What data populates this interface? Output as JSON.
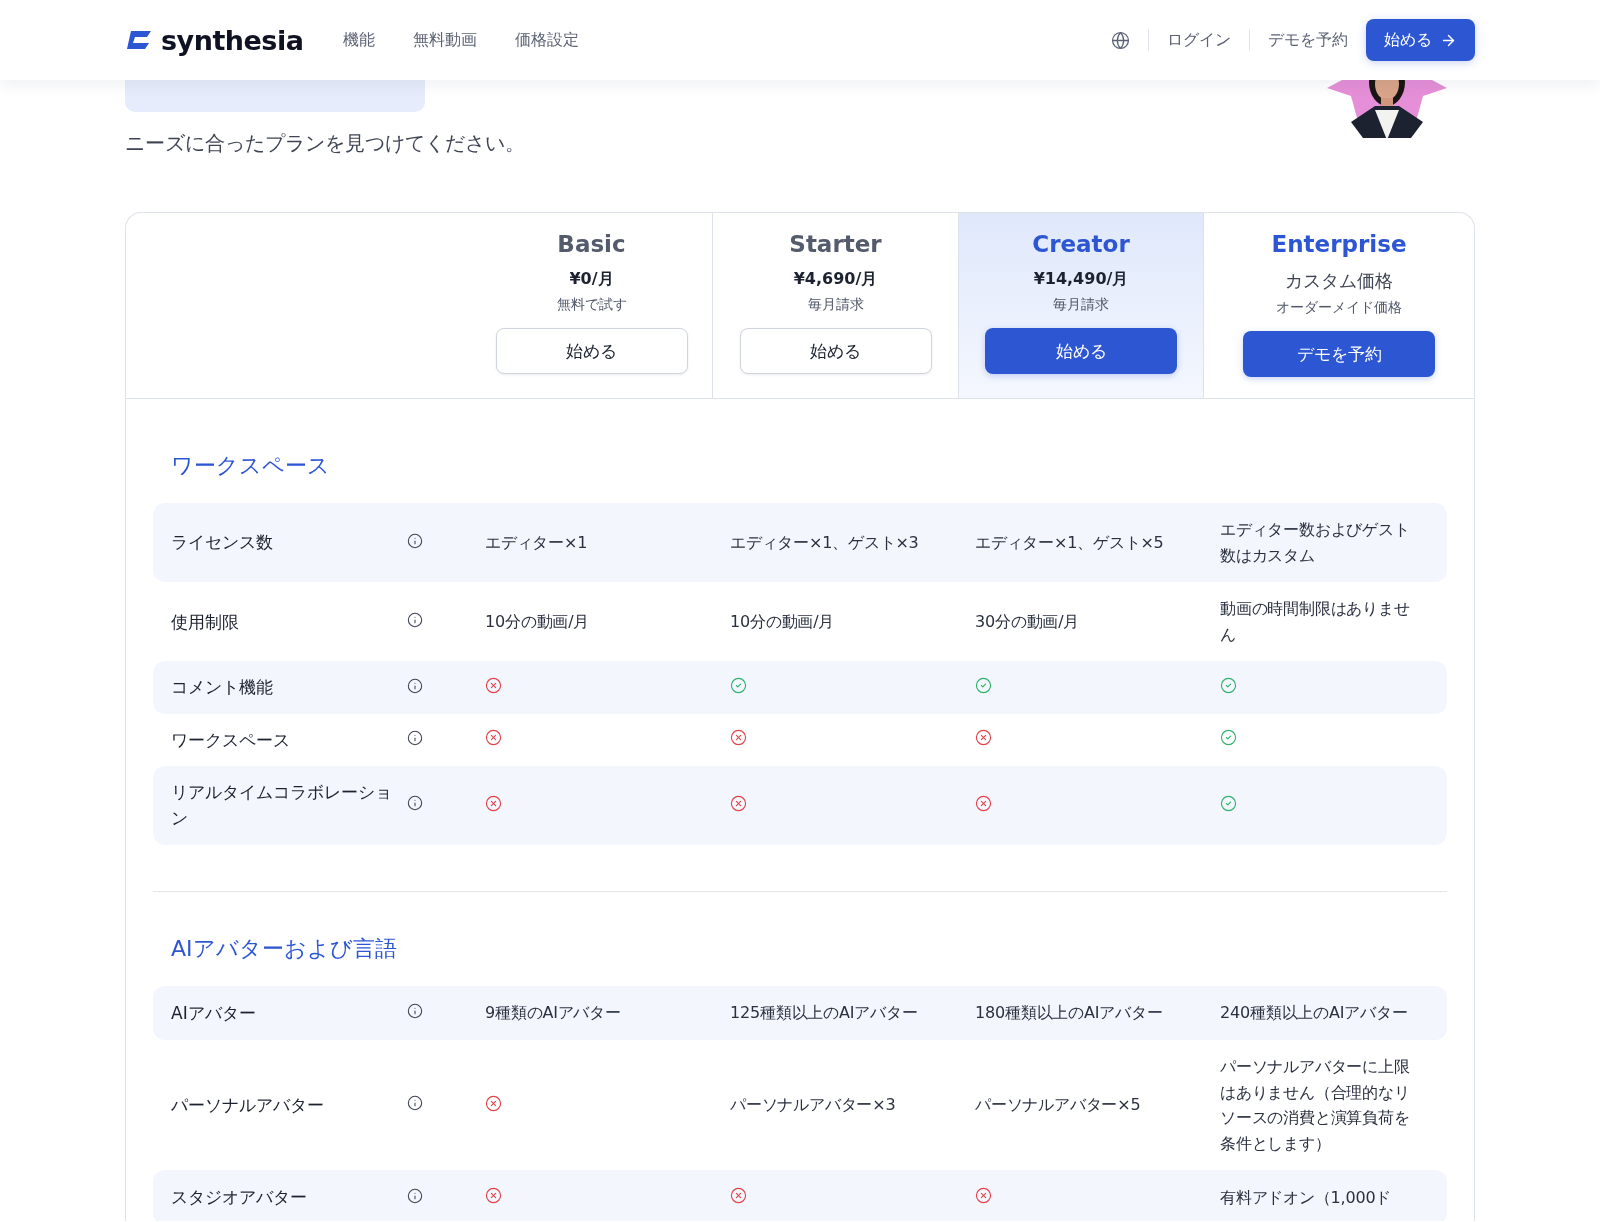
{
  "nav": {
    "logo": "synthesia",
    "links": [
      "機能",
      "無料動画",
      "価格設定"
    ],
    "login": "ログイン",
    "demo": "デモを予約",
    "cta": "始める"
  },
  "hero": {
    "subtitle": "ニーズに合ったプランを見つけてください。"
  },
  "plans": [
    {
      "name": "Basic",
      "price": "¥0/月",
      "note": "無料で試す",
      "button": "始める",
      "primary": false,
      "highlighted": false,
      "kind": "fixed"
    },
    {
      "name": "Starter",
      "price": "¥4,690/月",
      "note": "毎月請求",
      "button": "始める",
      "primary": false,
      "highlighted": false,
      "kind": "fixed"
    },
    {
      "name": "Creator",
      "price": "¥14,490/月",
      "note": "毎月請求",
      "button": "始める",
      "primary": true,
      "highlighted": true,
      "kind": "fixed"
    },
    {
      "name": "Enterprise",
      "price": "カスタム価格",
      "note": "オーダーメイド価格",
      "button": "デモを予約",
      "primary": true,
      "highlighted": false,
      "kind": "custom"
    }
  ],
  "sections": [
    {
      "title": "ワークスペース",
      "rows": [
        {
          "label": "ライセンス数",
          "cells": [
            {
              "kind": "text",
              "text": "エディター×1"
            },
            {
              "kind": "text",
              "text": "エディター×1、ゲスト×3"
            },
            {
              "kind": "text",
              "text": "エディター×1、ゲスト×5"
            },
            {
              "kind": "text",
              "text": "エディター数およびゲスト数はカスタム"
            }
          ]
        },
        {
          "label": "使用制限",
          "cells": [
            {
              "kind": "text",
              "text": "10分の動画/月"
            },
            {
              "kind": "text",
              "text": "10分の動画/月"
            },
            {
              "kind": "text",
              "text": "30分の動画/月"
            },
            {
              "kind": "text",
              "text": "動画の時間制限はありません"
            }
          ]
        },
        {
          "label": "コメント機能",
          "cells": [
            {
              "kind": "no"
            },
            {
              "kind": "yes"
            },
            {
              "kind": "yes"
            },
            {
              "kind": "yes"
            }
          ]
        },
        {
          "label": "ワークスペース",
          "cells": [
            {
              "kind": "no"
            },
            {
              "kind": "no"
            },
            {
              "kind": "no"
            },
            {
              "kind": "yes"
            }
          ]
        },
        {
          "label": "リアルタイムコラボレーション",
          "cells": [
            {
              "kind": "no"
            },
            {
              "kind": "no"
            },
            {
              "kind": "no"
            },
            {
              "kind": "yes"
            }
          ]
        }
      ]
    },
    {
      "title": "AIアバターおよび言語",
      "rows": [
        {
          "label": "AIアバター",
          "cells": [
            {
              "kind": "text",
              "text": "9種類のAIアバター"
            },
            {
              "kind": "text",
              "text": "125種類以上のAIアバター"
            },
            {
              "kind": "text",
              "text": "180種類以上のAIアバター"
            },
            {
              "kind": "text",
              "text": "240種類以上のAIアバター"
            }
          ]
        },
        {
          "label": "パーソナルアバター",
          "cells": [
            {
              "kind": "no"
            },
            {
              "kind": "text",
              "text": "パーソナルアバター×3"
            },
            {
              "kind": "text",
              "text": "パーソナルアバター×5"
            },
            {
              "kind": "text",
              "text": "パーソナルアバターに上限はありません（合理的なリソースの消費と演算負荷を条件とします）"
            }
          ]
        },
        {
          "label": "スタジオアバター",
          "cells": [
            {
              "kind": "no"
            },
            {
              "kind": "no"
            },
            {
              "kind": "no"
            },
            {
              "kind": "text",
              "text": "有料アドオン（1,000ド"
            }
          ]
        }
      ]
    }
  ]
}
